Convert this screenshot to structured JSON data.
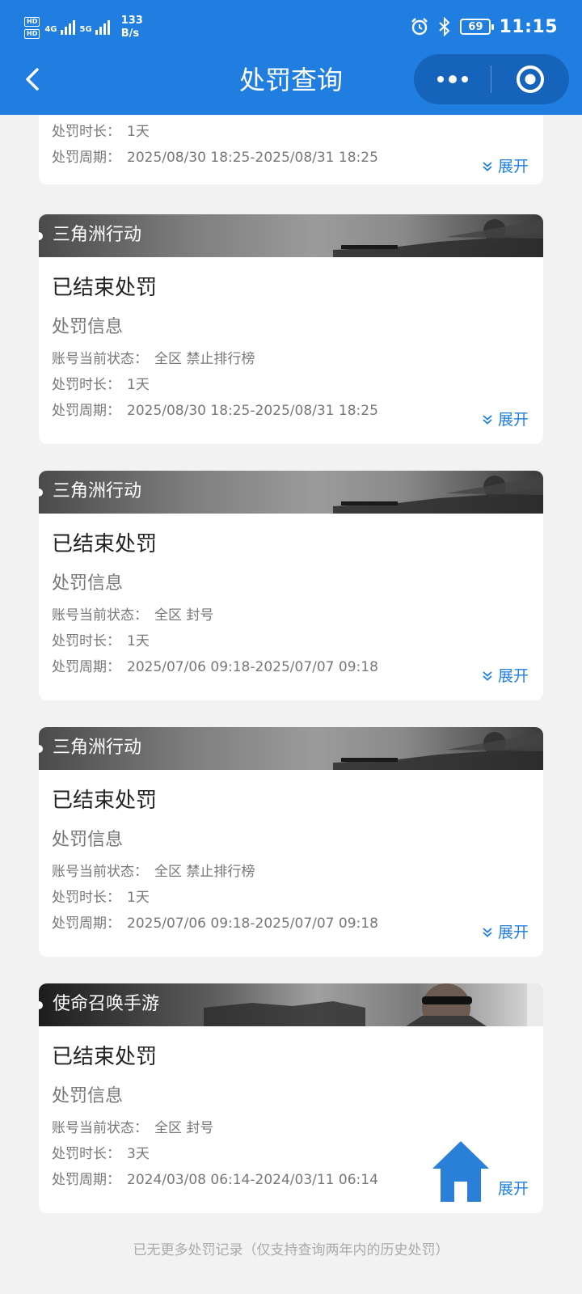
{
  "status_bar": {
    "hd1": "HD",
    "hd2": "HD",
    "net1": "4G",
    "net2": "5G",
    "speed_value": "133",
    "speed_unit": "B/s",
    "battery": "69",
    "time": "11:15"
  },
  "nav": {
    "title": "处罚查询"
  },
  "labels": {
    "status_key": "账号当前状态：",
    "duration_key": "处罚时长：",
    "period_key": "处罚周期：",
    "section": "处罚信息",
    "expand": "展开"
  },
  "partial_card": {
    "duration": "1天",
    "period": "2025/08/30 18:25-2025/08/31 18:25"
  },
  "records": [
    {
      "game": "三角洲行动",
      "status": "已结束处罚",
      "account_state": "全区 禁止排行榜",
      "duration": "1天",
      "period": "2025/08/30 18:25-2025/08/31 18:25"
    },
    {
      "game": "三角洲行动",
      "status": "已结束处罚",
      "account_state": "全区 封号",
      "duration": "1天",
      "period": "2025/07/06 09:18-2025/07/07 09:18"
    },
    {
      "game": "三角洲行动",
      "status": "已结束处罚",
      "account_state": "全区 禁止排行榜",
      "duration": "1天",
      "period": "2025/07/06 09:18-2025/07/07 09:18"
    },
    {
      "game": "使命召唤手游",
      "status": "已结束处罚",
      "account_state": "全区 封号",
      "duration": "3天",
      "period": "2024/03/08 06:14-2024/03/11 06:14"
    }
  ],
  "footer_note": "已无更多处罚记录（仅支持查询两年内的历史处罚）",
  "colors": {
    "primary": "#1f7ee0",
    "capsule": "#1563bb",
    "page_bg": "#f2f2f2"
  }
}
